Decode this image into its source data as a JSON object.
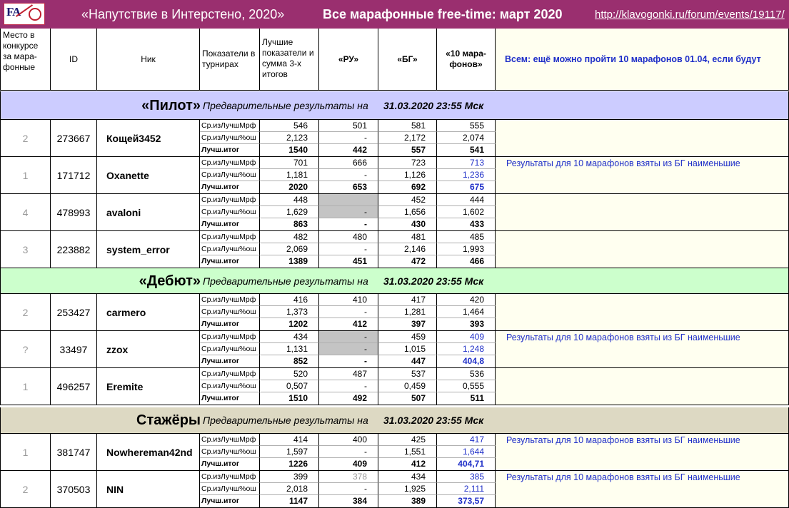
{
  "title": {
    "left": "«Напутствие в Интерстено, 2020»",
    "center": "Все марафонные free-time: март 2020",
    "link": "http://klavogonki.ru/forum/events/19117/",
    "logo_text": "FA"
  },
  "header": {
    "place": "Место в конкурсе за мара-фонные",
    "id": "ID",
    "nick": "Ник",
    "tournaments": "Показатели в турнирах",
    "best": "Лучшие показатели и сумма 3-х итогов",
    "ru": "«РУ»",
    "bg": "«БГ»",
    "ten": "«10 мара-фонов»",
    "note": "Всем: ещё можно пройти 10 марафонов 01.04, если будут"
  },
  "row_labels": [
    "Ср.изЛучшМрф",
    "Ср.изЛучш%ош",
    "Лучш.итог"
  ],
  "groups": [
    {
      "name": "«Пилот»",
      "prefix": "Предварительные результаты на",
      "date": "31.03.2020 23:55 Мск",
      "color": "#ccccff",
      "players": [
        {
          "place": "2",
          "id": "273667",
          "nick": "Кощей3452",
          "note": "",
          "best": [
            "546",
            "2,123",
            "1540"
          ],
          "ru": [
            "501",
            "-",
            "442"
          ],
          "bg": [
            "581",
            "2,172",
            "557"
          ],
          "ten": [
            "555",
            "2,074",
            "541"
          ]
        },
        {
          "place": "1",
          "id": "171712",
          "nick": "Oxanette",
          "note": "Результаты для 10 марафонов взяты из БГ наименьшие",
          "best": [
            "701",
            "1,181",
            "2020"
          ],
          "ru": [
            "666",
            "-",
            "653"
          ],
          "bg": [
            "723",
            "1,126",
            "692"
          ],
          "ten": [
            "713",
            "1,236",
            "675"
          ]
        },
        {
          "place": "4",
          "id": "478993",
          "nick": "avaloni",
          "note": "",
          "best": [
            "448",
            "1,629",
            "863"
          ],
          "ru": [
            "",
            "-",
            "-"
          ],
          "bg": [
            "452",
            "1,656",
            "430"
          ],
          "ten": [
            "444",
            "1,602",
            "433"
          ]
        },
        {
          "place": "3",
          "id": "223882",
          "nick": "system_error",
          "note": "",
          "best": [
            "482",
            "2,069",
            "1389"
          ],
          "ru": [
            "480",
            "-",
            "451"
          ],
          "bg": [
            "481",
            "2,146",
            "472"
          ],
          "ten": [
            "485",
            "1,993",
            "466"
          ]
        }
      ]
    },
    {
      "name": "«Дебют»",
      "prefix": "Предварительные результаты на",
      "date": "31.03.2020 23:55 Мск",
      "color": "#ccffcc",
      "players": [
        {
          "place": "2",
          "id": "253427",
          "nick": "carmero",
          "note": "",
          "best": [
            "416",
            "1,373",
            "1202"
          ],
          "ru": [
            "410",
            "-",
            "412"
          ],
          "bg": [
            "417",
            "1,281",
            "397"
          ],
          "ten": [
            "420",
            "1,464",
            "393"
          ]
        },
        {
          "place": "?",
          "id": "33497",
          "nick": "zzox",
          "note": "Результаты для 10 марафонов взяты из БГ наименьшие",
          "best": [
            "434",
            "1,131",
            "852"
          ],
          "ru": [
            "-",
            "-",
            "-"
          ],
          "bg": [
            "459",
            "1,015",
            "447"
          ],
          "ten": [
            "409",
            "1,248",
            "404,8"
          ]
        },
        {
          "place": "1",
          "id": "496257",
          "nick": "Eremite",
          "note": "",
          "best": [
            "520",
            "0,507",
            "1510"
          ],
          "ru": [
            "487",
            "-",
            "492"
          ],
          "bg": [
            "537",
            "0,459",
            "507"
          ],
          "ten": [
            "536",
            "0,555",
            "511"
          ]
        }
      ]
    },
    {
      "name": "Стажёры",
      "prefix": "Предварительные результаты на",
      "date": "31.03.2020 23:55 Мск",
      "color": "#ddd9c3",
      "players": [
        {
          "place": "1",
          "id": "381747",
          "nick": "Nowhereman42nd",
          "note": "Результаты для 10 марафонов взяты из БГ наименьшие",
          "best": [
            "414",
            "1,597",
            "1226"
          ],
          "ru": [
            "400",
            "-",
            "409"
          ],
          "bg": [
            "425",
            "1,551",
            "412"
          ],
          "ten": [
            "417",
            "1,644",
            "404,71"
          ]
        },
        {
          "place": "2",
          "id": "370503",
          "nick": "NIN",
          "note": "Результаты для 10 марафонов взяты из БГ наименьшие",
          "best": [
            "399",
            "2,018",
            "1147"
          ],
          "ru": [
            "378",
            "-",
            "384"
          ],
          "bg": [
            "434",
            "1,925",
            "389"
          ],
          "ten": [
            "385",
            "2,111",
            "373,57"
          ]
        }
      ]
    }
  ],
  "colors": {
    "title_bar": "#9a2f6f",
    "note_blue": "#1f2fc8",
    "note_bg": "#fffff0",
    "shaded_cell": "#c4c4c4",
    "place_grey": "#9a9a9a"
  }
}
